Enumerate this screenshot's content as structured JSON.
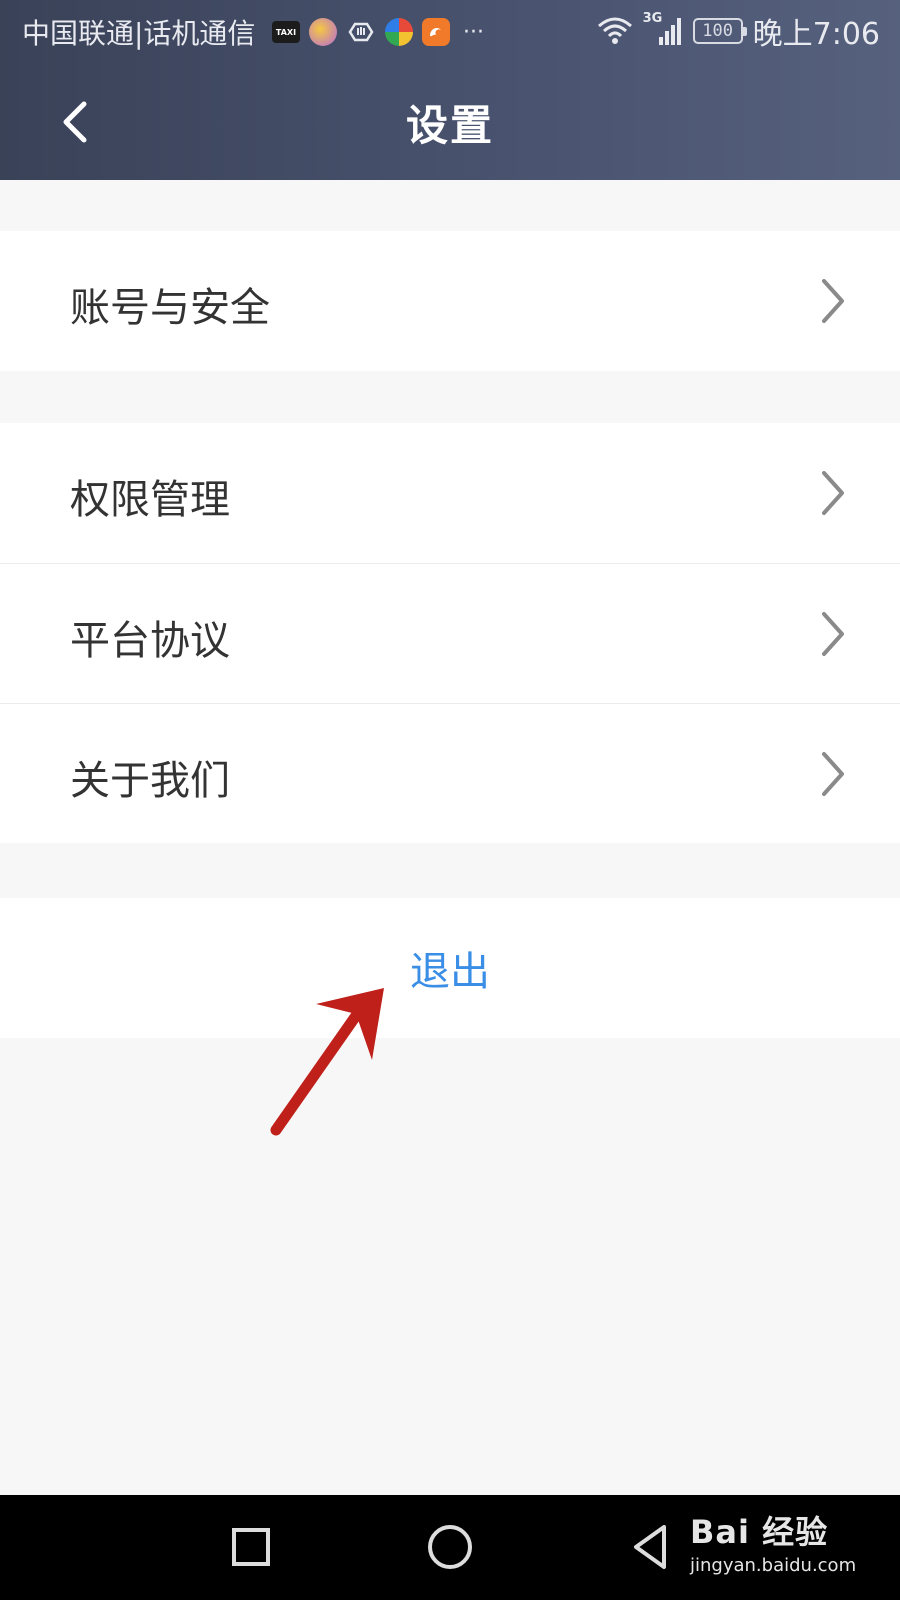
{
  "status_bar": {
    "carrier": "中国联通|话机通信",
    "notification_icons": [
      "taxi-icon",
      "app-icon-yellow",
      "hand-icon",
      "browser-icon",
      "uc-browser-icon"
    ],
    "network_type": "3G",
    "battery": "100",
    "time": "晚上7:06"
  },
  "header": {
    "title": "设置"
  },
  "settings": {
    "group1": [
      {
        "label": "账号与安全"
      }
    ],
    "group2": [
      {
        "label": "权限管理"
      },
      {
        "label": "平台协议"
      },
      {
        "label": "关于我们"
      }
    ],
    "logout_label": "退出"
  },
  "annotation": {
    "arrow_color": "#c0201a"
  },
  "watermark": {
    "logo": "Bai 经验",
    "url": "jingyan.baidu.com"
  },
  "colors": {
    "header_bg": "#444c66",
    "logout_text": "#3a8ee6",
    "page_bg": "#f7f7f7"
  }
}
